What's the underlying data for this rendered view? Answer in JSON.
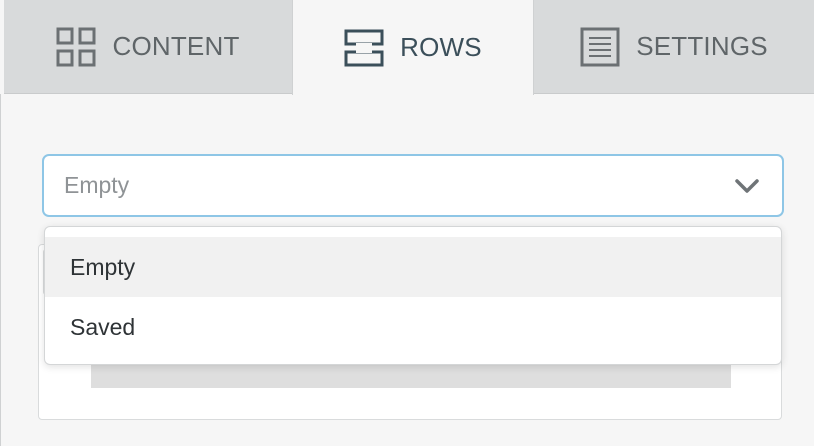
{
  "tabs": [
    {
      "label": "CONTENT",
      "icon": "grid-icon"
    },
    {
      "label": "ROWS",
      "icon": "rows-icon",
      "active": true
    },
    {
      "label": "SETTINGS",
      "icon": "document-lines-icon"
    }
  ],
  "row_select": {
    "value": "Empty",
    "options": [
      "Empty",
      "Saved"
    ],
    "highlighted": "Empty"
  },
  "colors": {
    "tab_bg": "#d8dadb",
    "active_tab_bg": "#f6f6f6",
    "focus_border": "#8ec6e6",
    "option_hover": "#f1f1f1"
  }
}
